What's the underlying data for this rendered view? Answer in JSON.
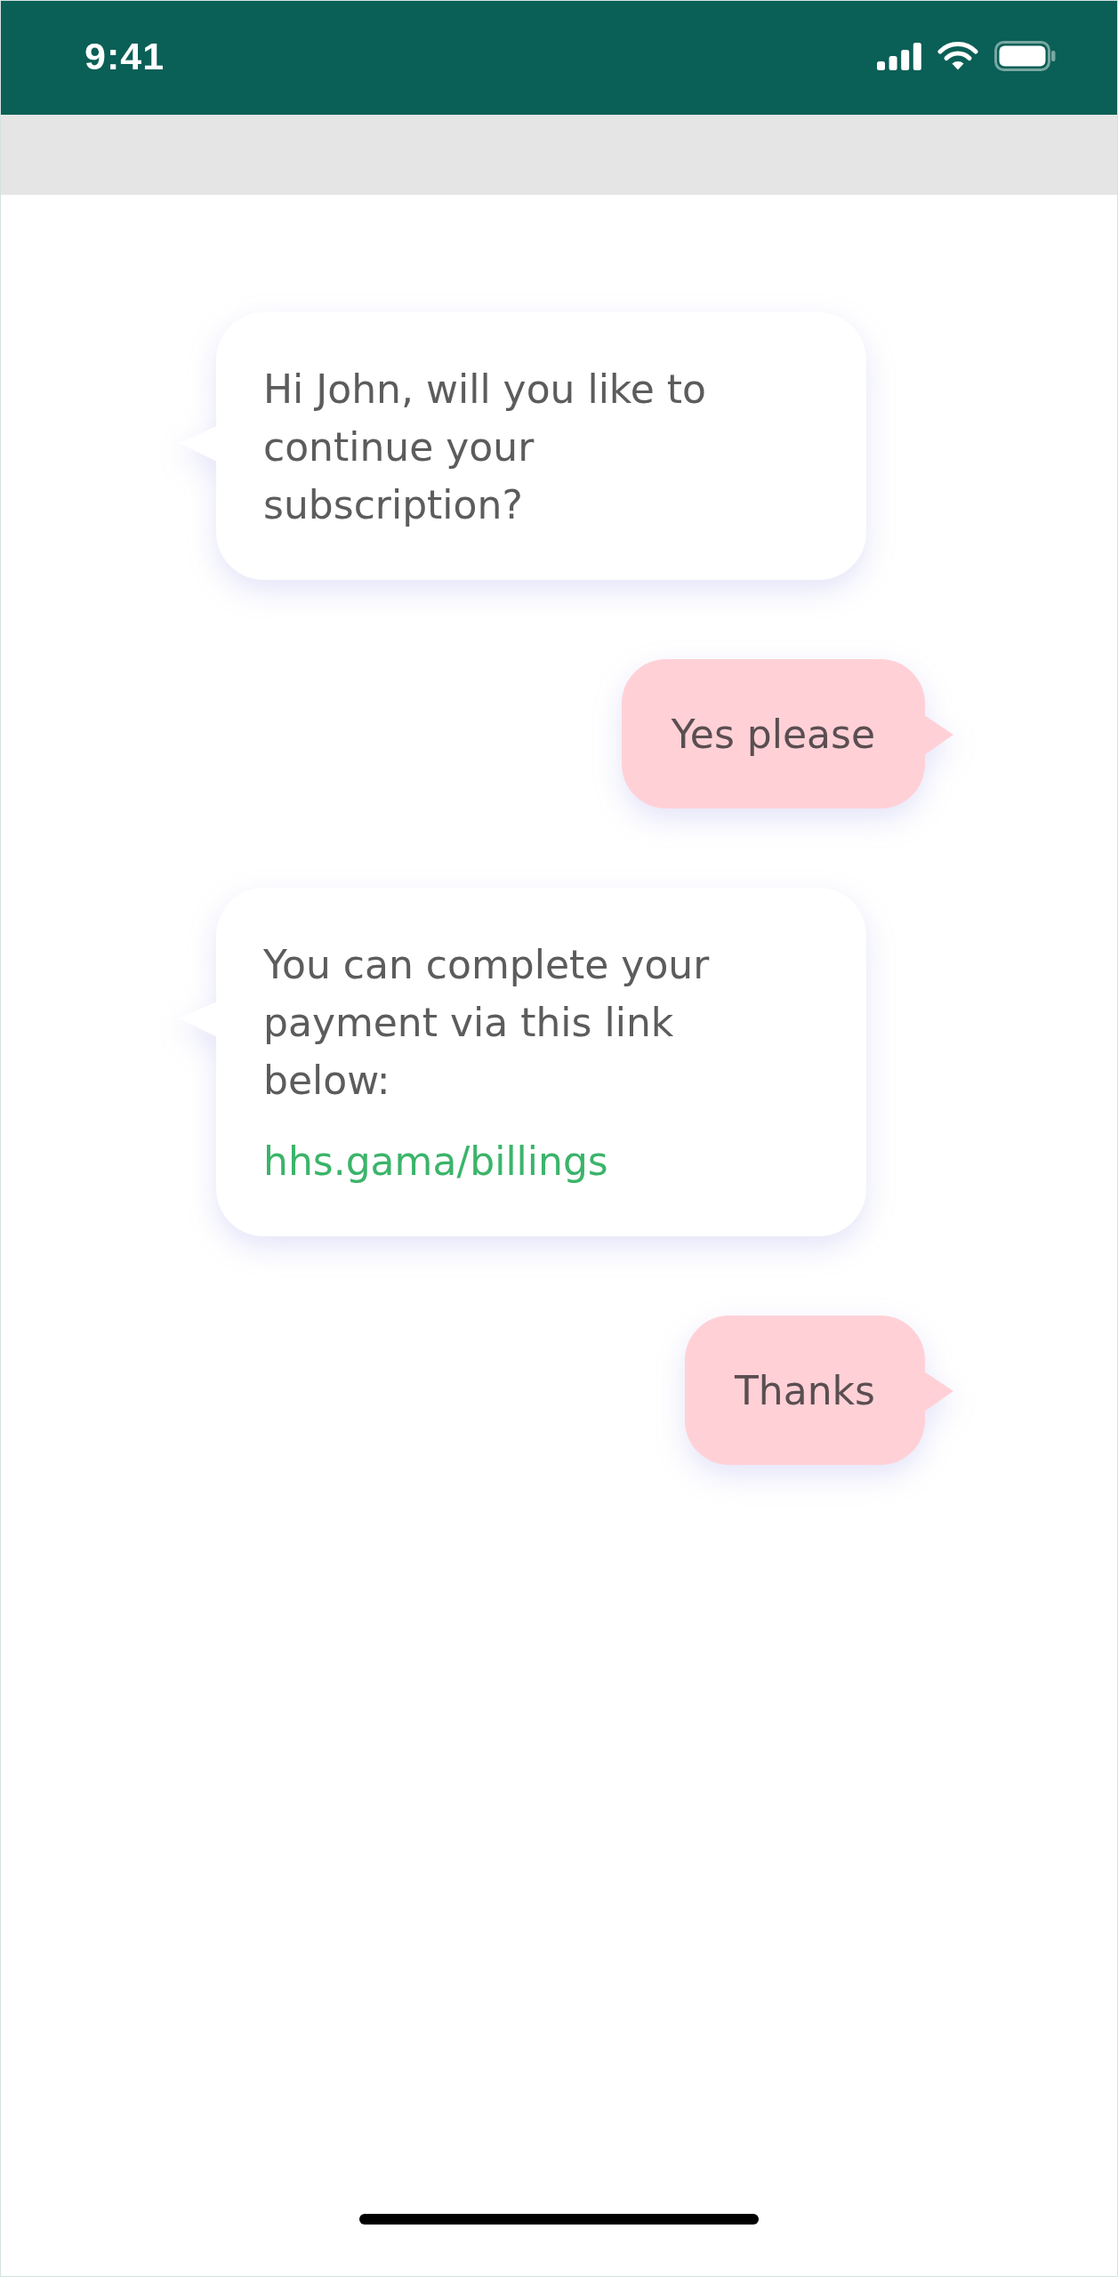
{
  "status_bar": {
    "time": "9:41"
  },
  "messages": [
    {
      "kind": "received",
      "text": "Hi John, will you like to continue your subscription?"
    },
    {
      "kind": "sent",
      "text": "Yes please"
    },
    {
      "kind": "received",
      "text": "You can complete your payment via this link below:",
      "link": "hhs.gama/billings"
    },
    {
      "kind": "sent",
      "text": "Thanks"
    }
  ]
}
